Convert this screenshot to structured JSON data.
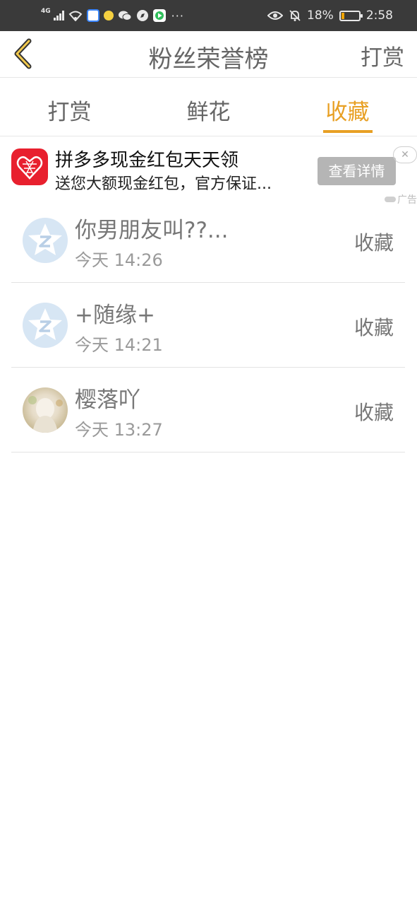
{
  "status_bar": {
    "network": "4G",
    "dots": "···",
    "battery_text": "18%",
    "battery_level": 0.18,
    "time": "2:58"
  },
  "nav": {
    "title": "粉丝荣誉榜",
    "action_label": "打赏"
  },
  "tabs": [
    {
      "label": "打赏",
      "active": false
    },
    {
      "label": "鲜花",
      "active": false
    },
    {
      "label": "收藏",
      "active": true
    }
  ],
  "ad": {
    "title": "拼多多现金红包天天领",
    "description": "送您大额现金红包，官方保证...",
    "button_label": "查看详情",
    "close_label": "✕",
    "tag": "广告"
  },
  "list": [
    {
      "name": "你男朋友叫??...",
      "time": "今天 14:26",
      "type": "收藏",
      "avatar": "default-avatar-icon"
    },
    {
      "name": "+随缘+",
      "time": "今天 14:21",
      "type": "收藏",
      "avatar": "default-avatar-icon"
    },
    {
      "name": "樱落吖",
      "time": "今天 13:27",
      "type": "收藏",
      "avatar": "photo-avatar"
    }
  ],
  "colors": {
    "accent": "#e8a024",
    "status_bar_bg": "#3a3a3a",
    "ad_logo": "#e8202e"
  }
}
